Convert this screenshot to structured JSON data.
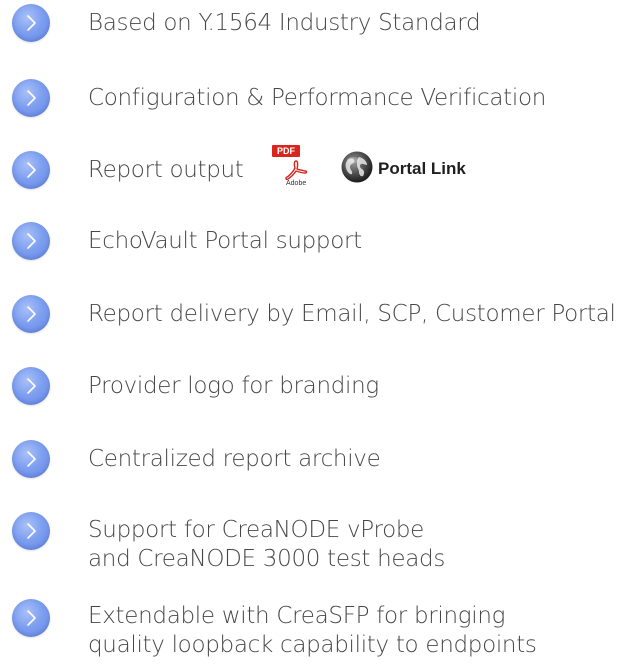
{
  "features": [
    {
      "lines": [
        "Based on Y.1564 Industry Standard"
      ]
    },
    {
      "lines": [
        "Configuration & Performance Verification"
      ]
    },
    {
      "lines": [
        "Report output"
      ]
    },
    {
      "lines": [
        "EchoVault Portal support"
      ]
    },
    {
      "lines": [
        "Report delivery by Email, SCP, Customer Portal"
      ]
    },
    {
      "lines": [
        "Provider logo for branding"
      ]
    },
    {
      "lines": [
        "Centralized report archive"
      ]
    },
    {
      "lines": [
        "Support for CreaNODE vProbe",
        "and CreaNODE 3000 test heads"
      ]
    },
    {
      "lines": [
        "Extendable with CreaSFP for bringing",
        "quality loopback capability to endpoints"
      ]
    }
  ],
  "report_icons": {
    "pdf_badge": "PDF",
    "pdf_brand": "Adobe",
    "portal_label": "Portal Link"
  },
  "colors": {
    "bullet": "#7e9ff0",
    "text": "#474747",
    "pdf_red": "#d9261c"
  },
  "icons": {
    "bullet": "chevron-right-icon",
    "pdf": "pdf-file-icon",
    "portal": "globe-icon"
  }
}
